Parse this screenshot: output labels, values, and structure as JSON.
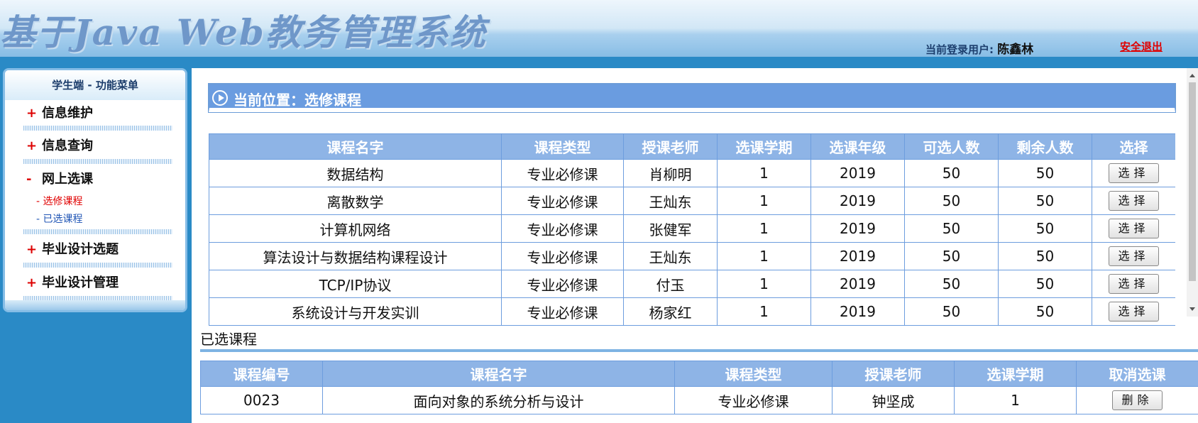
{
  "header": {
    "title": "基于Java Web教务管理系统",
    "user_label": "当前登录用户:",
    "user_name": "陈鑫林",
    "logout": "安全退出"
  },
  "sidebar": {
    "title": "学生端 - 功能菜单",
    "items": [
      {
        "sign": "+",
        "label": "信息维护"
      },
      {
        "sign": "+",
        "label": "信息查询"
      },
      {
        "sign": "-",
        "label": "网上选课"
      },
      {
        "sign": "+",
        "label": "毕业设计选题"
      },
      {
        "sign": "+",
        "label": "毕业设计管理"
      }
    ],
    "sub_items": [
      {
        "label": "- 选修课程",
        "color": "#e00000"
      },
      {
        "label": "- 已选课程",
        "color": "#2055b5"
      }
    ]
  },
  "location": {
    "text": "当前位置：选修课程"
  },
  "course_table": {
    "headers": [
      "课程名字",
      "课程类型",
      "授课老师",
      "选课学期",
      "选课年级",
      "可选人数",
      "剩余人数",
      "选择"
    ],
    "rows": [
      [
        "数据结构",
        "专业必修课",
        "肖柳明",
        "1",
        "2019",
        "50",
        "50"
      ],
      [
        "离散数学",
        "专业必修课",
        "王灿东",
        "1",
        "2019",
        "50",
        "50"
      ],
      [
        "计算机网络",
        "专业必修课",
        "张健军",
        "1",
        "2019",
        "50",
        "50"
      ],
      [
        "算法设计与数据结构课程设计",
        "专业必修课",
        "王灿东",
        "1",
        "2019",
        "50",
        "50"
      ],
      [
        "TCP/IP协议",
        "专业必修课",
        "付玉",
        "1",
        "2019",
        "50",
        "50"
      ],
      [
        "系统设计与开发实训",
        "专业必修课",
        "杨家红",
        "1",
        "2019",
        "50",
        "50"
      ]
    ],
    "button": "选择"
  },
  "selected": {
    "title": "已选课程",
    "headers": [
      "课程编号",
      "课程名字",
      "课程类型",
      "授课老师",
      "选课学期",
      "取消选课"
    ],
    "rows": [
      [
        "0023",
        "面向对象的系统分析与设计",
        "专业必修课",
        "钟坚成",
        "1"
      ]
    ],
    "button": "删除"
  },
  "colors": {
    "accent": "#6a9ce0",
    "table_header": "#8eb4e6",
    "frame": "#2a8ac6"
  }
}
